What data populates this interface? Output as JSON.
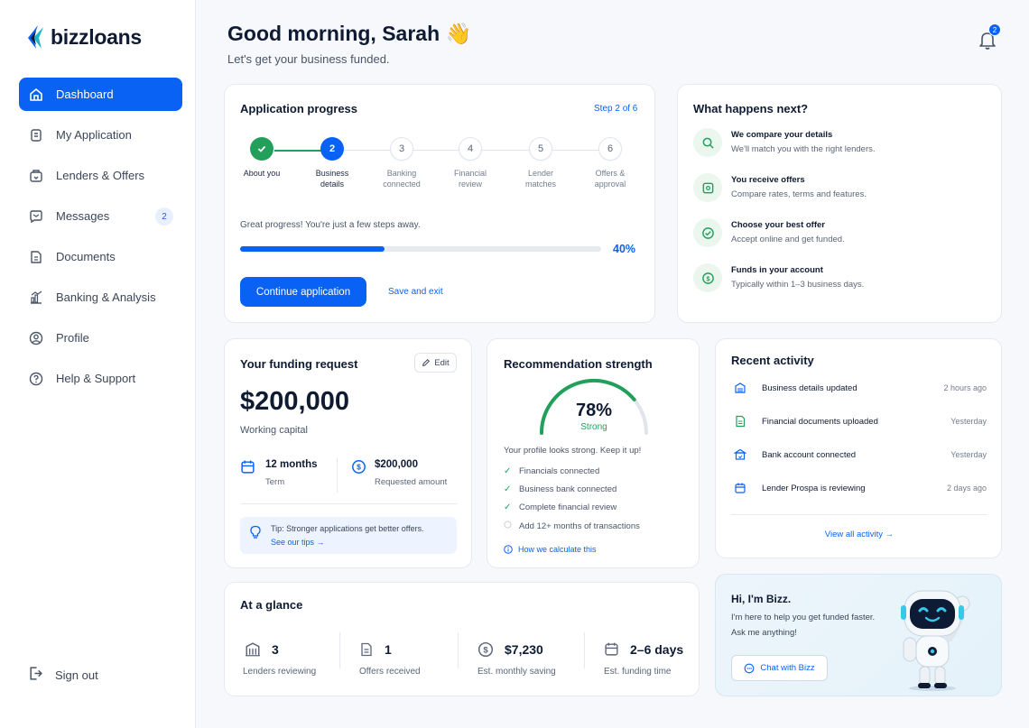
{
  "app": {
    "logo_text": "bizzloans"
  },
  "sidebar": {
    "items": [
      {
        "label": "Dashboard",
        "icon": "home-icon"
      },
      {
        "label": "My Application",
        "icon": "application-icon"
      },
      {
        "label": "Lenders & Offers",
        "icon": "lenders-icon"
      },
      {
        "label": "Messages",
        "icon": "messages-icon",
        "badge": "2"
      },
      {
        "label": "Documents",
        "icon": "document-icon"
      },
      {
        "label": "Banking & Analysis",
        "icon": "chart-icon"
      },
      {
        "label": "Profile",
        "icon": "profile-icon"
      },
      {
        "label": "Help & Support",
        "icon": "help-icon"
      }
    ],
    "active_index": 0,
    "signout_label": "Sign out"
  },
  "header": {
    "greeting": "Good morning, Sarah 👋",
    "subtitle": "Let's get your business funded.",
    "notification_count": "2"
  },
  "progress": {
    "title": "Application progress",
    "step_text": "Step 2 of 6",
    "steps": [
      {
        "num": "",
        "label": "About you",
        "state": "done"
      },
      {
        "num": "2",
        "label": "Business details",
        "state": "current"
      },
      {
        "num": "3",
        "label": "Banking connected",
        "state": "todo"
      },
      {
        "num": "4",
        "label": "Financial review",
        "state": "todo"
      },
      {
        "num": "5",
        "label": "Lender matches",
        "state": "todo"
      },
      {
        "num": "6",
        "label": "Offers & approval",
        "state": "todo"
      }
    ],
    "message": "Great progress! You're just a few steps away.",
    "percent_text": "40%",
    "percent_value": 0.4,
    "continue_label": "Continue application",
    "save_label": "Save and exit"
  },
  "next": {
    "title": "What happens next?",
    "items": [
      {
        "title": "We compare your details",
        "desc": "We'll match you with the right lenders.",
        "icon": "search-icon"
      },
      {
        "title": "You receive offers",
        "desc": "Compare rates, terms and features.",
        "icon": "offer-icon"
      },
      {
        "title": "Choose your best offer",
        "desc": "Accept online and get funded.",
        "icon": "check-circle-icon"
      },
      {
        "title": "Funds in your account",
        "desc": "Typically within 1–3 business days.",
        "icon": "dollar-icon"
      }
    ]
  },
  "funding": {
    "title": "Your funding request",
    "edit_label": "Edit",
    "amount": "$200,000",
    "purpose": "Working capital",
    "term_value": "12 months",
    "term_label": "Term",
    "requested_value": "$200,000",
    "requested_label": "Requested amount",
    "tip_text": "Tip: Stronger applications get better offers.",
    "tip_link": "See our tips →"
  },
  "recommendation": {
    "title": "Recommendation strength",
    "percent": "78%",
    "percent_value": 0.78,
    "rating": "Strong",
    "message": "Your profile looks strong. Keep it up!",
    "checks": [
      {
        "label": "Financials connected",
        "done": true
      },
      {
        "label": "Business bank connected",
        "done": true
      },
      {
        "label": "Complete financial review",
        "done": true
      },
      {
        "label": "Add 12+ months of transactions",
        "done": false
      }
    ],
    "link": "How we calculate this"
  },
  "activity": {
    "title": "Recent activity",
    "items": [
      {
        "text": "Business details updated",
        "time": "2 hours ago",
        "icon": "building-icon"
      },
      {
        "text": "Financial documents uploaded",
        "time": "Yesterday",
        "icon": "document-icon"
      },
      {
        "text": "Bank account connected",
        "time": "Yesterday",
        "icon": "bank-icon"
      },
      {
        "text": "Lender Prospa is reviewing",
        "time": "2 days ago",
        "icon": "calendar-icon"
      }
    ],
    "view_all": "View all activity →"
  },
  "glance": {
    "title": "At a glance",
    "items": [
      {
        "value": "3",
        "label": "Lenders reviewing",
        "icon": "building-icon"
      },
      {
        "value": "1",
        "label": "Offers received",
        "icon": "document-icon"
      },
      {
        "value": "$7,230",
        "label": "Est. monthly saving",
        "icon": "dollar-icon"
      },
      {
        "value": "2–6 days",
        "label": "Est. funding time",
        "icon": "calendar-icon"
      }
    ]
  },
  "bizz": {
    "title": "Hi, I'm Bizz.",
    "line1": "I'm here to help you get funded faster.",
    "line2": "Ask me anything!",
    "button": "Chat with Bizz"
  },
  "colors": {
    "accent": "#0a62f5",
    "success": "#22a05b",
    "text": "#0f1b33"
  }
}
